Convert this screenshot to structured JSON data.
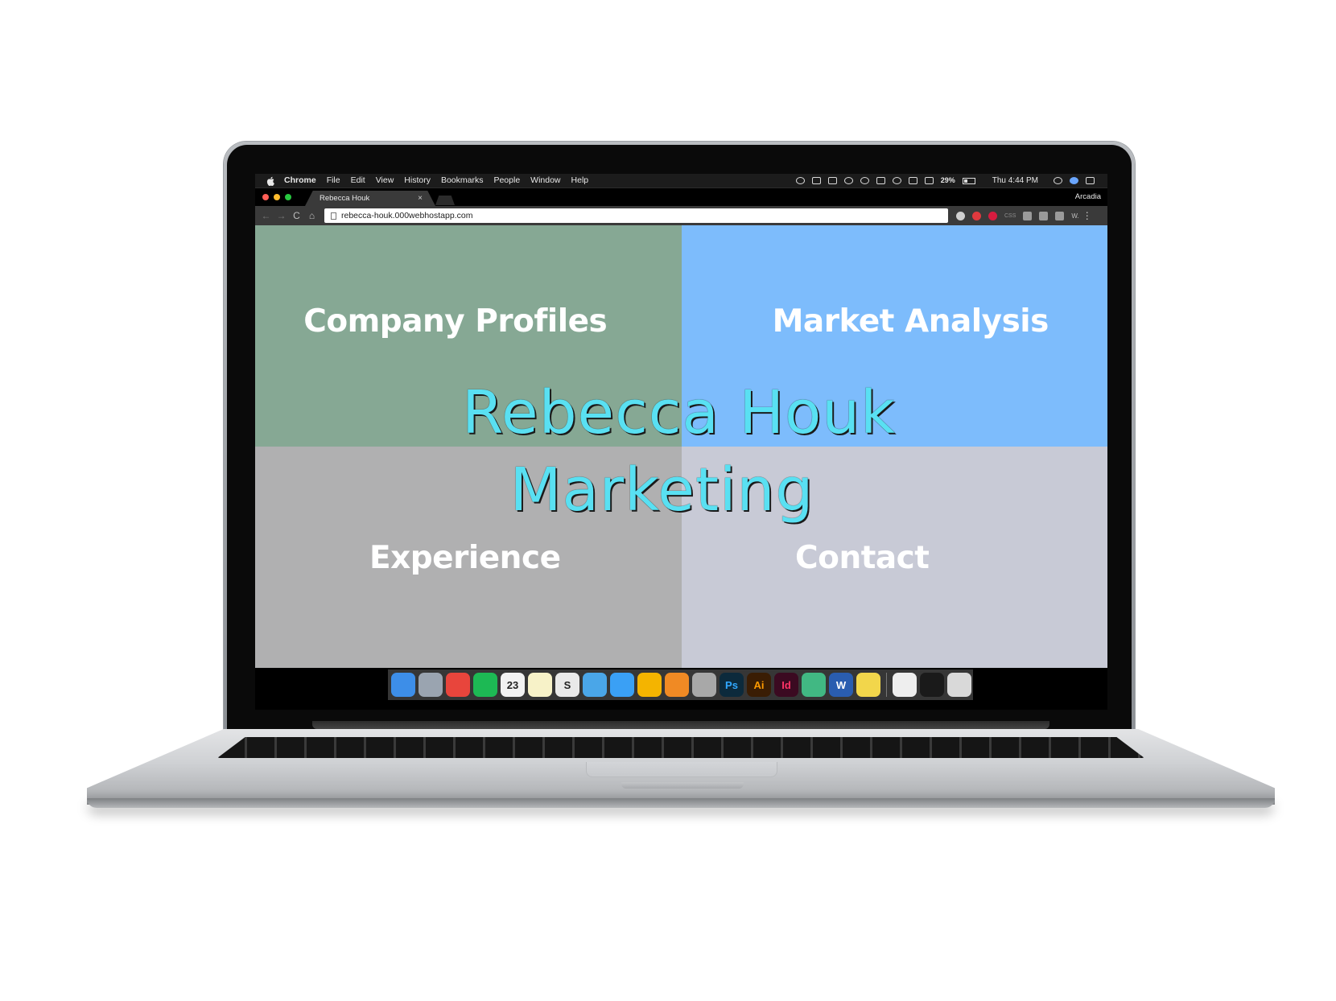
{
  "menubar": {
    "items": [
      "Chrome",
      "File",
      "Edit",
      "View",
      "History",
      "Bookmarks",
      "People",
      "Window",
      "Help"
    ],
    "battery": "29%",
    "clock": "Thu 4:44 PM"
  },
  "browser": {
    "tab_title": "Rebecca Houk",
    "tab_close": "×",
    "profile_name": "Arcadia",
    "url": "rebecca-houk.000webhostapp.com",
    "back_icon": "←",
    "forward_icon": "→",
    "reload_icon": "C",
    "home_icon": "⌂",
    "menu_icon": "⋮",
    "ext_css": "CSS",
    "ext_w": "W."
  },
  "site": {
    "title_line1": "Rebecca Houk",
    "title_line2": "Marketing",
    "tiles": [
      {
        "label": "Company Profiles",
        "color": "#86a894"
      },
      {
        "label": "Market Analysis",
        "color": "#7dbcfc"
      },
      {
        "label": "Experience",
        "color": "#b0b0b1"
      },
      {
        "label": "Contact",
        "color": "#c8cad6"
      }
    ],
    "title_color": "#59e0f2"
  },
  "dock": {
    "apps": [
      {
        "name": "finder-icon",
        "glyph": "",
        "color": "#3d8ee8"
      },
      {
        "name": "launchpad-icon",
        "glyph": "",
        "color": "#9aa4b0"
      },
      {
        "name": "chrome-icon",
        "glyph": "",
        "color": "#e8453c"
      },
      {
        "name": "spotify-icon",
        "glyph": "",
        "color": "#1db954"
      },
      {
        "name": "calendar-icon",
        "glyph": "23",
        "color": "#f2f2f2"
      },
      {
        "name": "notes-icon",
        "glyph": "",
        "color": "#f7f2c8"
      },
      {
        "name": "slack-icon",
        "glyph": "S",
        "color": "#e9e9e9"
      },
      {
        "name": "screen-sharing-icon",
        "glyph": "",
        "color": "#4aa6e8"
      },
      {
        "name": "messages-icon",
        "glyph": "",
        "color": "#3aa0f5"
      },
      {
        "name": "photos-icon",
        "glyph": "",
        "color": "#f4b400"
      },
      {
        "name": "ibooks-icon",
        "glyph": "",
        "color": "#f08a24"
      },
      {
        "name": "preview-icon",
        "glyph": "",
        "color": "#a8a8a8"
      },
      {
        "name": "photoshop-icon",
        "glyph": "Ps",
        "color": "#0c2a3c"
      },
      {
        "name": "illustrator-icon",
        "glyph": "Ai",
        "color": "#3a1d04"
      },
      {
        "name": "indesign-icon",
        "glyph": "Id",
        "color": "#3b0a21"
      },
      {
        "name": "atom-icon",
        "glyph": "",
        "color": "#41b883"
      },
      {
        "name": "word-icon",
        "glyph": "W",
        "color": "#2a5db0"
      },
      {
        "name": "stickies-icon",
        "glyph": "",
        "color": "#f2d64b"
      },
      {
        "name": "document-icon",
        "glyph": "",
        "color": "#eeeeee"
      },
      {
        "name": "terminal-icon",
        "glyph": "",
        "color": "#1a1a1a"
      },
      {
        "name": "trash-icon",
        "glyph": "",
        "color": "#d9d9d9"
      }
    ]
  }
}
